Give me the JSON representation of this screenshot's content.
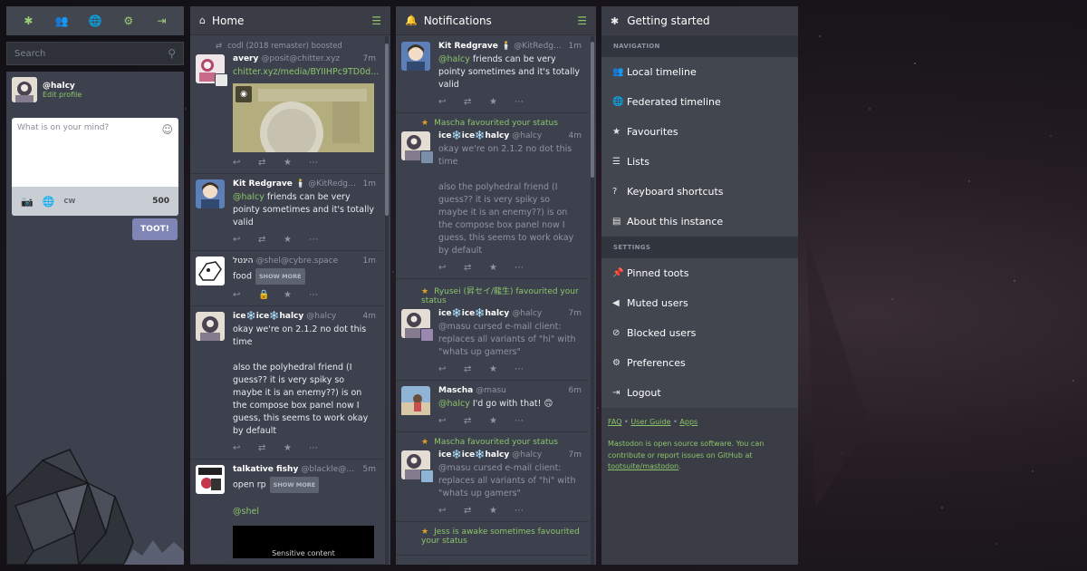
{
  "drawer": {
    "tabs": [
      {
        "icon": "asterisk-icon",
        "glyph": "✱"
      },
      {
        "icon": "users-icon",
        "glyph": "👥"
      },
      {
        "icon": "globe-icon",
        "glyph": "🌐"
      },
      {
        "icon": "gear-icon",
        "glyph": "⚙"
      },
      {
        "icon": "sign-out-icon",
        "glyph": "⇥"
      }
    ],
    "search_placeholder": "Search",
    "me": {
      "handle": "@halcy",
      "edit_label": "Edit profile"
    },
    "compose": {
      "placeholder": "What is on your mind?",
      "cw_label": "CW",
      "char_count": "500",
      "toot_label": "TOOT!"
    }
  },
  "home": {
    "title": "Home",
    "statuses": [
      {
        "prepend": "codl (2018 remaster) boosted",
        "name": "avery",
        "acct": "@posit@chitter.xyz",
        "time": "7m",
        "link": "chitter.xyz/media/BYIIHPc9TD0d..."
      },
      {
        "name": "Kit Redgrave 🕯️",
        "acct": "@KitRedgra...",
        "time": "1m",
        "mention": "@halcy",
        "text": " friends can be very pointy sometimes and it's totally valid"
      },
      {
        "name": "הינטל",
        "acct": "@shel@cybre.space",
        "time": "1m",
        "text": "food",
        "show_more": "SHOW MORE"
      },
      {
        "name": "ice❄️ice❄️halcy",
        "acct": "@halcy",
        "time": "4m",
        "p1": "okay we're on 2.1.2 no dot this time",
        "p2": "also the polyhedral friend (I guess?? it is very spiky so maybe it is an enemy??) is on the compose box panel now I guess, this seems to work okay by default"
      },
      {
        "name": "talkative fishy",
        "acct": "@blackle@dev....",
        "time": "5m",
        "text": "open rp",
        "show_more": "SHOW MORE",
        "mention": "@shel",
        "sensitive": "Sensitive content"
      }
    ]
  },
  "notifications": {
    "title": "Notifications",
    "items": [
      {
        "name": "Kit Redgrave 🕯️",
        "acct": "@KitRedgra...",
        "time": "1m",
        "mention": "@halcy",
        "text": " friends can be very pointy sometimes and it's totally valid"
      },
      {
        "prepend": "Mascha favourited your status",
        "name": "ice❄️ice❄️halcy",
        "acct": "@halcy",
        "time": "4m",
        "p1": "okay we're on 2.1.2 no dot this time",
        "p2": "also the polyhedral friend (I guess?? it is very spiky so maybe it is an enemy??) is on the compose box panel now I guess, this seems to work okay by default"
      },
      {
        "prepend": "Ryusei (昇セイ/龍生) favourited your status",
        "name": "ice❄️ice❄️halcy",
        "acct": "@halcy",
        "time": "7m",
        "text": "@masu cursed e-mail client: replaces all variants of \"hi\" with \"whats up gamers\""
      },
      {
        "name": "Mascha",
        "acct": "@masu",
        "time": "6m",
        "mention": "@halcy",
        "text": " I'd go with that! 🙃"
      },
      {
        "prepend": "Mascha favourited your status",
        "name": "ice❄️ice❄️halcy",
        "acct": "@halcy",
        "time": "7m",
        "text": "@masu cursed e-mail client: replaces all variants of \"hi\" with \"whats up gamers\""
      },
      {
        "prepend": "Jess is awake sometimes favourited your status"
      }
    ]
  },
  "getting_started": {
    "title": "Getting started",
    "nav_heading": "NAVIGATION",
    "nav_items": [
      {
        "label": "Local timeline",
        "icon": "users-icon",
        "glyph": "👥"
      },
      {
        "label": "Federated timeline",
        "icon": "globe-icon",
        "glyph": "🌐"
      },
      {
        "label": "Favourites",
        "icon": "star-icon",
        "glyph": "★"
      },
      {
        "label": "Lists",
        "icon": "list-icon",
        "glyph": "☰"
      },
      {
        "label": "Keyboard shortcuts",
        "icon": "question-icon",
        "glyph": "?"
      },
      {
        "label": "About this instance",
        "icon": "book-icon",
        "glyph": "▤"
      }
    ],
    "settings_heading": "SETTINGS",
    "settings_items": [
      {
        "label": "Pinned toots",
        "icon": "thumbtack-icon",
        "glyph": "📌"
      },
      {
        "label": "Muted users",
        "icon": "volume-off-icon",
        "glyph": "◀"
      },
      {
        "label": "Blocked users",
        "icon": "ban-icon",
        "glyph": "⊘"
      },
      {
        "label": "Preferences",
        "icon": "gear-icon",
        "glyph": "⚙"
      },
      {
        "label": "Logout",
        "icon": "sign-out-icon",
        "glyph": "⇥"
      }
    ],
    "footer": {
      "faq": "FAQ",
      "sep": " • ",
      "user_guide": "User Guide",
      "apps": "Apps",
      "about_prefix": "Mastodon is open source software. You can contribute or report issues on GitHub at ",
      "repo": "tootsuite/mastodon",
      "about_suffix": "."
    }
  }
}
